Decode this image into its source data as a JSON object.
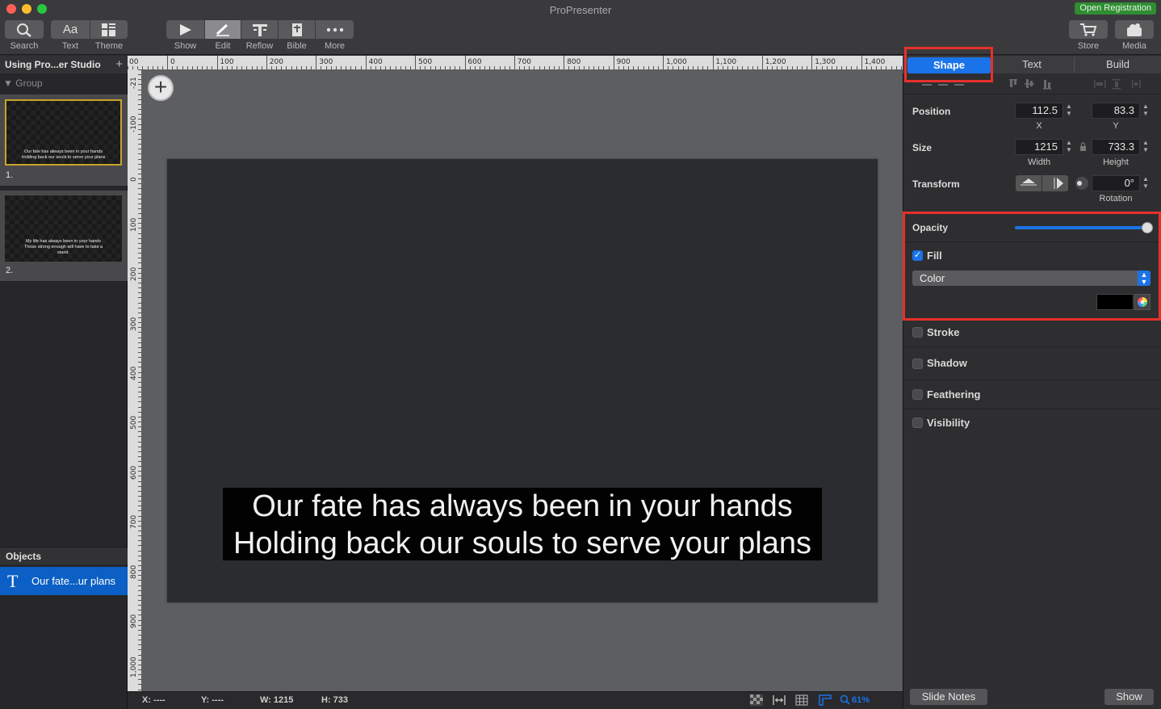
{
  "window": {
    "title": "ProPresenter",
    "registration_label": "Open Registration"
  },
  "toolbar": {
    "search": "Search",
    "text": "Text",
    "theme": "Theme",
    "show": "Show",
    "edit": "Edit",
    "reflow": "Reflow",
    "bible": "Bible",
    "more": "More",
    "store": "Store",
    "media": "Media",
    "text_icon_glyph": "Aa"
  },
  "library": {
    "title": "Using Pro...er Studio",
    "add_glyph": "+",
    "group_label": "Group",
    "slides": [
      {
        "number": "1.",
        "lines": [
          "Our fate has always been in your hands",
          "Holding back our souls to serve your plans"
        ]
      },
      {
        "number": "2.",
        "lines": [
          "My life has always been in your hands",
          "Those strong enough will have to take a",
          "stand."
        ]
      }
    ]
  },
  "objects": {
    "header": "Objects",
    "items": [
      {
        "icon": "T",
        "label": "Our fate...ur plans"
      }
    ]
  },
  "ruler": {
    "top_labels": [
      "00",
      "0",
      "100",
      "200",
      "300",
      "400",
      "500",
      "600",
      "700",
      "800",
      "900",
      "1,000",
      "1,100",
      "1,200",
      "1,300",
      "1,400"
    ],
    "left_labels": [
      "-21",
      "-100",
      "0",
      "100",
      "200",
      "300",
      "400",
      "500",
      "600",
      "700",
      "800",
      "900",
      "1,000"
    ]
  },
  "slide": {
    "line1": "Our fate has always been in your hands",
    "line2": "Holding back our souls to serve your plans"
  },
  "statusbar": {
    "x": "X: ----",
    "y": "Y: ----",
    "w": "W: 1215",
    "h": "H: 733",
    "zoom": "61%"
  },
  "inspector": {
    "tabs": [
      "Shape",
      "Text",
      "Build"
    ],
    "position": {
      "label": "Position",
      "x": "112.5",
      "y": "83.3",
      "x_label": "X",
      "y_label": "Y"
    },
    "size": {
      "label": "Size",
      "width": "1215",
      "height": "733.3",
      "width_label": "Width",
      "height_label": "Height"
    },
    "transform": {
      "label": "Transform",
      "rotation": "0°",
      "rotation_label": "Rotation"
    },
    "opacity": {
      "label": "Opacity",
      "value": 1.0
    },
    "fill": {
      "label": "Fill",
      "checked": true,
      "type": "Color",
      "color": "#000000"
    },
    "stroke": {
      "label": "Stroke",
      "checked": false
    },
    "shadow": {
      "label": "Shadow",
      "checked": false
    },
    "feathering": {
      "label": "Feathering",
      "checked": false
    },
    "visibility": {
      "label": "Visibility",
      "checked": false
    },
    "slide_notes": "Slide Notes",
    "show": "Show"
  },
  "colors": {
    "accent": "#1a73e8",
    "highlight": "#e8302a",
    "selected_slide_border": "#c9a22b",
    "registration": "#2f8d32"
  }
}
